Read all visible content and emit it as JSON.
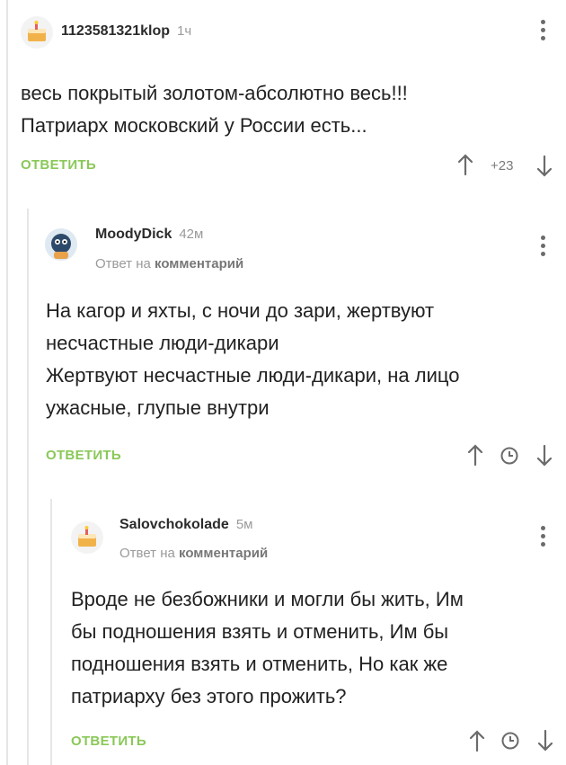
{
  "comments": [
    {
      "author": "1123581321klop",
      "time": "1ч",
      "lines": [
        "весь покрытый золотом-абсолютно весь!!!",
        "Патриарх московский у России есть..."
      ],
      "reply_label": "ОТВЕТИТЬ",
      "rating": "+23"
    },
    {
      "author": "MoodyDick",
      "time": "42м",
      "reply_to_prefix": "Ответ на",
      "reply_to_target": "комментарий",
      "lines": [
        "На кагор и яхты, с ночи до зари, жертвуют",
        "несчастные люди-дикари",
        "Жертвуют несчастные люди-дикари, на лицо",
        "ужасные, глупые внутри"
      ],
      "reply_label": "ОТВЕТИТЬ"
    },
    {
      "author": "Salovchokolade",
      "time": "5м",
      "reply_to_prefix": "Ответ на",
      "reply_to_target": "комментарий",
      "lines": [
        "Вроде не безбожники и могли бы жить, Им",
        "бы подношения взять и отменить, Им бы",
        "подношения взять и отменить, Но как же",
        "патриарху без этого прожить?"
      ],
      "reply_label": "ОТВЕТИТЬ"
    }
  ],
  "colors": {
    "accent": "#8ac858",
    "thread_line": "#e6e6e6",
    "muted": "#9a9a9a"
  },
  "icons": [
    "cake-avatar-icon",
    "character-avatar-icon",
    "more-menu-icon",
    "upvote-arrow-icon",
    "downvote-arrow-icon",
    "clock-icon"
  ]
}
